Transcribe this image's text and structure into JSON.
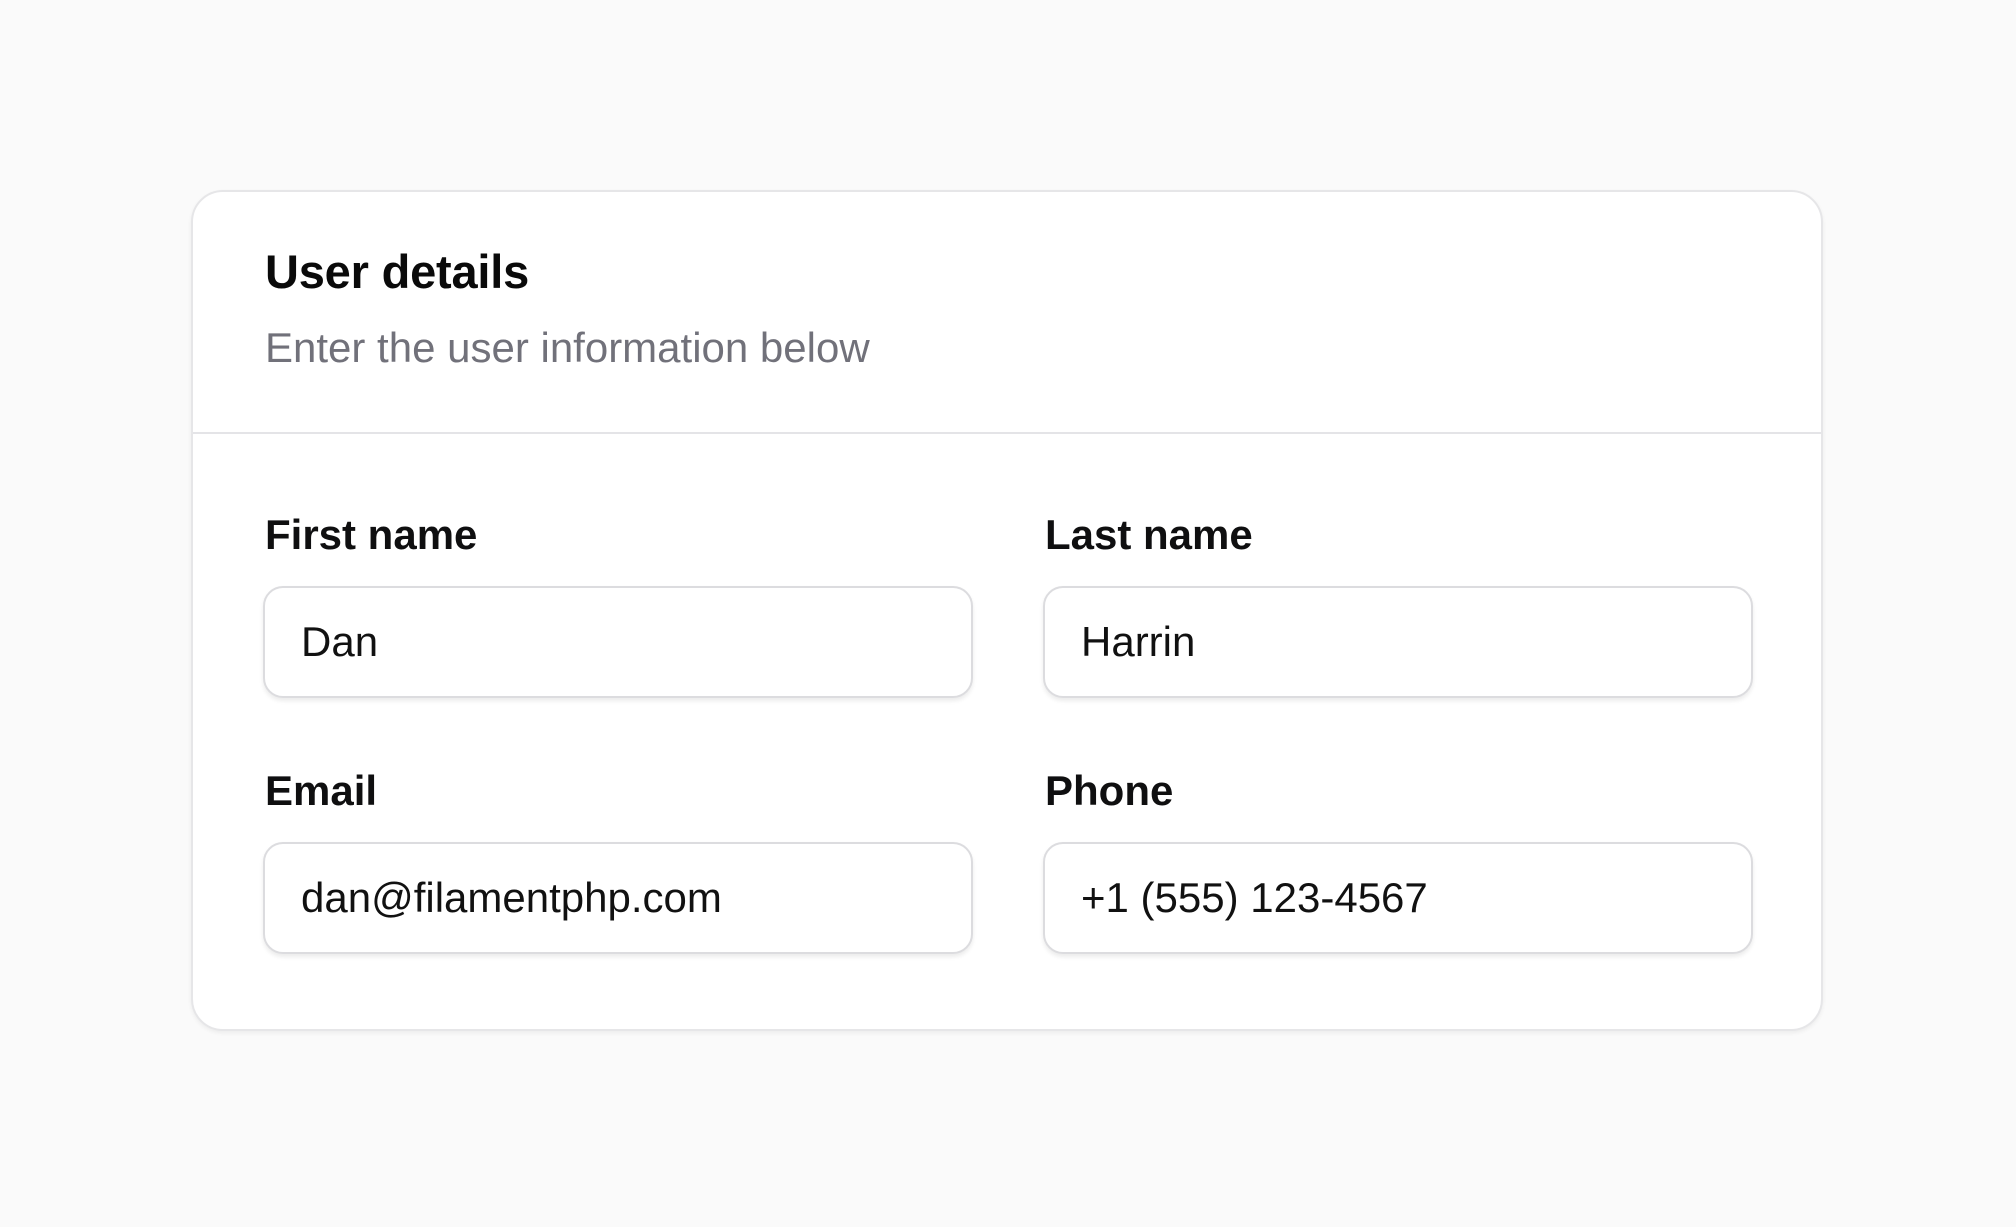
{
  "card": {
    "title": "User details",
    "description": "Enter the user information below"
  },
  "fields": {
    "first_name": {
      "label": "First name",
      "value": "Dan"
    },
    "last_name": {
      "label": "Last name",
      "value": "Harrin"
    },
    "email": {
      "label": "Email",
      "value": "dan@filamentphp.com"
    },
    "phone": {
      "label": "Phone",
      "value": "+1 (555) 123-4567"
    }
  },
  "colors": {
    "page_background": "#fafafa",
    "card_background": "#ffffff",
    "border": "#e4e4e7",
    "muted_text": "#71717a"
  }
}
